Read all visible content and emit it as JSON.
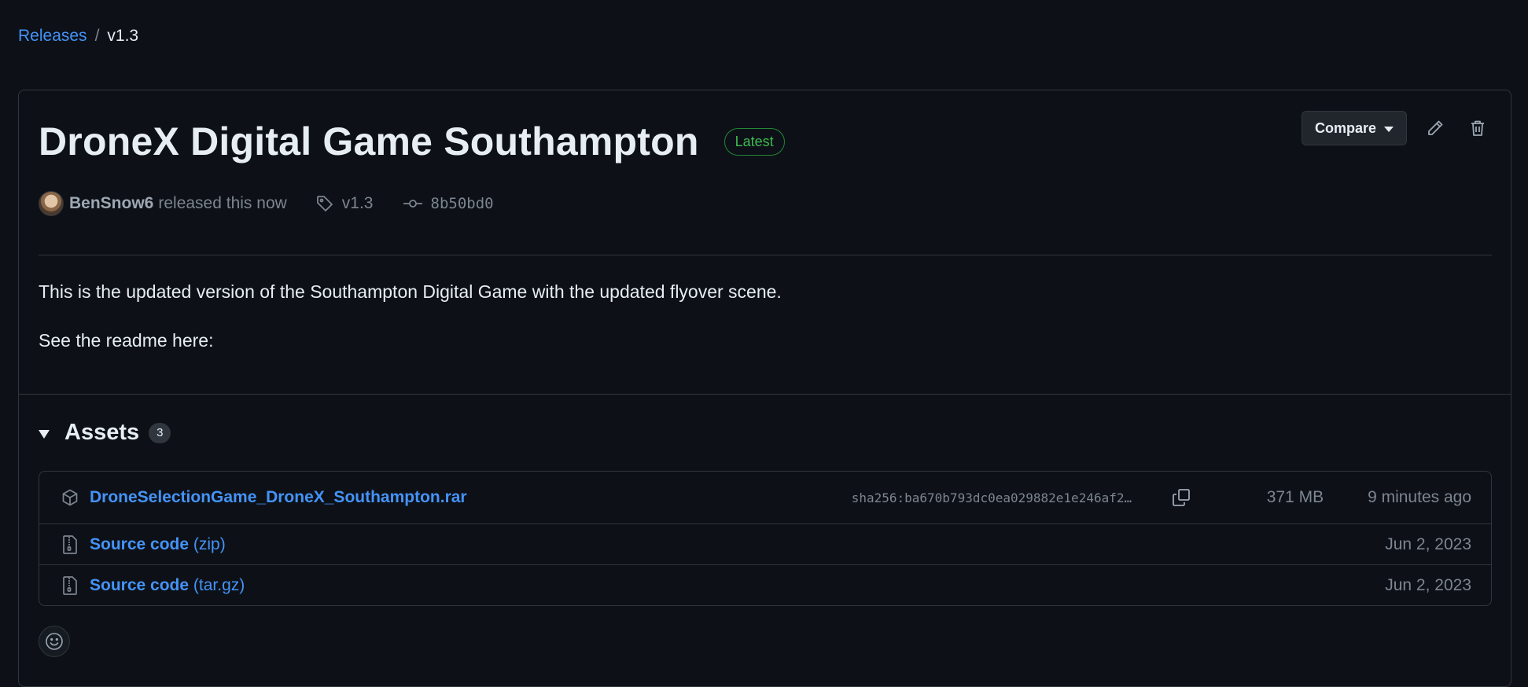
{
  "breadcrumb": {
    "parent": "Releases",
    "separator": "/",
    "current": "v1.3"
  },
  "release": {
    "title": "DroneX Digital Game Southampton",
    "badge": "Latest",
    "author": "BenSnow6",
    "released_text": "released this now",
    "tag": "v1.3",
    "commit": "8b50bd0",
    "body": [
      "This is the updated version of the Southampton Digital Game with the updated flyover scene.",
      "See the readme here:"
    ]
  },
  "actions": {
    "compare_label": "Compare"
  },
  "icons": {
    "edit": "pencil-icon",
    "delete": "trash-icon",
    "tag": "tag-icon",
    "commit": "git-commit-icon",
    "package": "package-icon",
    "zip": "file-zip-icon",
    "copy": "copy-icon",
    "reaction": "smiley-icon"
  },
  "assets": {
    "title": "Assets",
    "count": "3",
    "items": [
      {
        "name": "DroneSelectionGame_DroneX_Southampton.rar",
        "sha": "sha256:ba670b793dc0ea029882e1e246af2…",
        "size": "371 MB",
        "date": "9 minutes ago"
      },
      {
        "name": "Source code",
        "suffix": "(zip)",
        "date": "Jun 2, 2023"
      },
      {
        "name": "Source code",
        "suffix": "(tar.gz)",
        "date": "Jun 2, 2023"
      }
    ]
  },
  "colors": {
    "background": "#0d1117",
    "link": "#4493f8",
    "latest_badge": "#3fb950",
    "border": "#30363d",
    "muted": "#7d8590"
  }
}
